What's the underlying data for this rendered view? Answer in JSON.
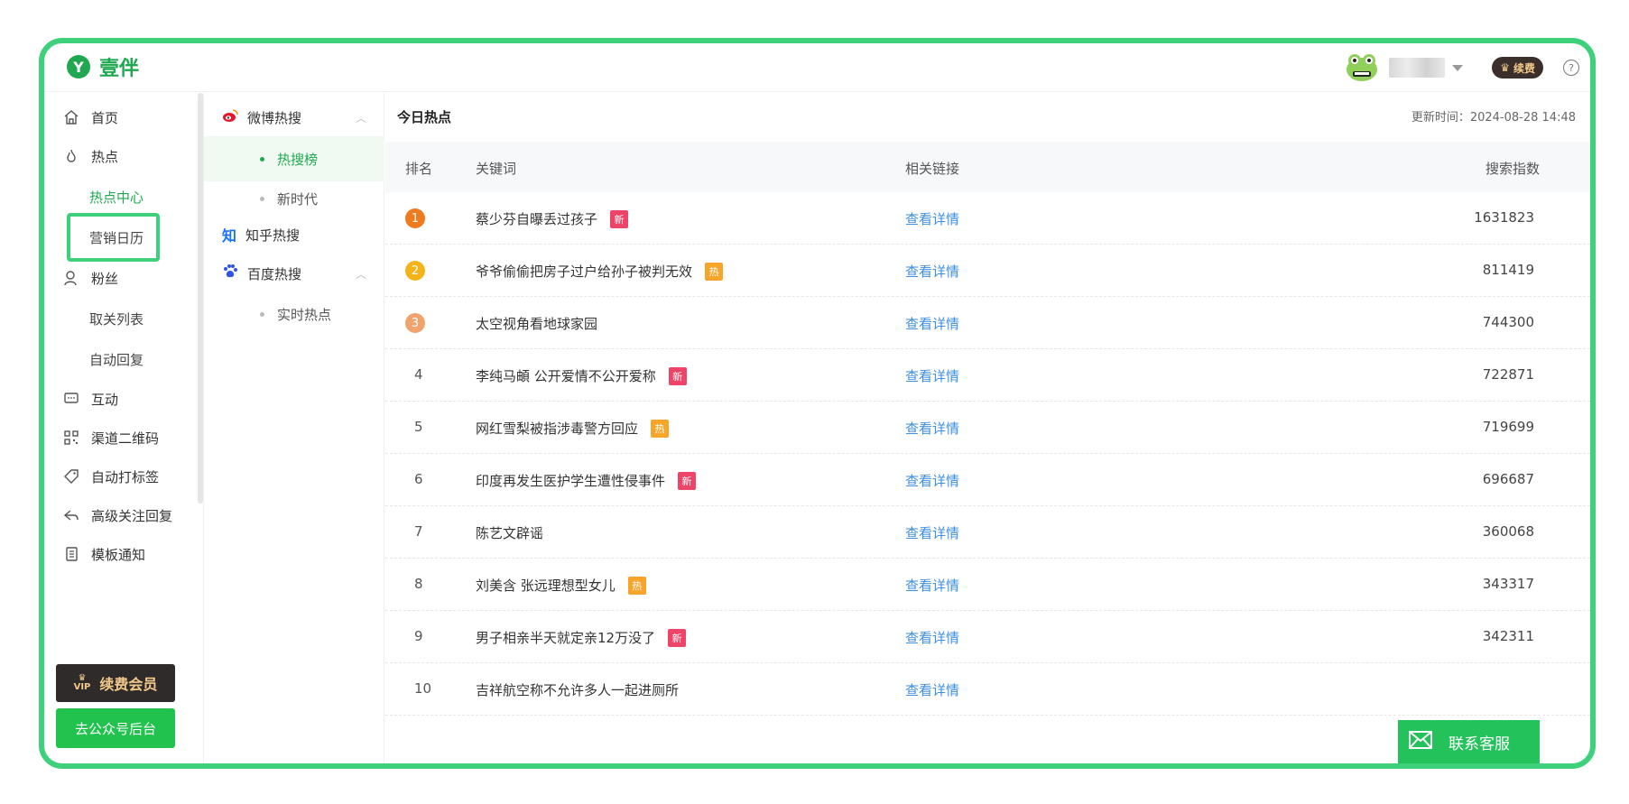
{
  "brand": {
    "logo_letter": "Y",
    "name": "壹伴"
  },
  "header": {
    "renew_label": "续费",
    "help": "?"
  },
  "sidebar": {
    "items": [
      {
        "label": "首页",
        "icon": "home-icon"
      },
      {
        "label": "热点",
        "icon": "flame-icon"
      },
      {
        "label": "热点中心",
        "sub": true,
        "active": true
      },
      {
        "label": "营销日历",
        "sub": true
      },
      {
        "label": "粉丝",
        "icon": "user-icon"
      },
      {
        "label": "取关列表",
        "sub": true
      },
      {
        "label": "自动回复",
        "sub": true
      },
      {
        "label": "互动",
        "icon": "chat-icon"
      },
      {
        "label": "渠道二维码",
        "icon": "qrcode-icon"
      },
      {
        "label": "自动打标签",
        "icon": "tag-icon"
      },
      {
        "label": "高级关注回复",
        "icon": "reply-icon"
      },
      {
        "label": "模板通知",
        "icon": "document-icon"
      }
    ],
    "vip_button": "续费会员",
    "vip_crown_text": "VIP",
    "go_button": "去公众号后台"
  },
  "sources": {
    "weibo": {
      "label": "微博热搜",
      "children": [
        "热搜榜",
        "新时代"
      ]
    },
    "zhihu": {
      "label": "知乎热搜",
      "icon_text": "知"
    },
    "baidu": {
      "label": "百度热搜",
      "children": [
        "实时热点"
      ]
    }
  },
  "main": {
    "title": "今日热点",
    "updated": "更新时间：2024-08-28 14:48",
    "columns": {
      "rank": "排名",
      "keyword": "关键词",
      "link": "相关链接",
      "index": "搜索指数"
    },
    "rows": [
      {
        "rank": "1",
        "keyword": "蔡少芬自曝丢过孩子",
        "tag": "新",
        "tag_type": "new",
        "link": "查看详情",
        "index": "1631823"
      },
      {
        "rank": "2",
        "keyword": "爷爷偷偷把房子过户给孙子被判无效",
        "tag": "热",
        "tag_type": "hot",
        "link": "查看详情",
        "index": "811419"
      },
      {
        "rank": "3",
        "keyword": "太空视角看地球家园",
        "tag": "",
        "tag_type": "",
        "link": "查看详情",
        "index": "744300"
      },
      {
        "rank": "4",
        "keyword": "李纯马頔 公开爱情不公开爱称",
        "tag": "新",
        "tag_type": "new",
        "link": "查看详情",
        "index": "722871"
      },
      {
        "rank": "5",
        "keyword": "网红雪梨被指涉毒警方回应",
        "tag": "热",
        "tag_type": "hot",
        "link": "查看详情",
        "index": "719699"
      },
      {
        "rank": "6",
        "keyword": "印度再发生医护学生遭性侵事件",
        "tag": "新",
        "tag_type": "new",
        "link": "查看详情",
        "index": "696687"
      },
      {
        "rank": "7",
        "keyword": "陈艺文辟谣",
        "tag": "",
        "tag_type": "",
        "link": "查看详情",
        "index": "360068"
      },
      {
        "rank": "8",
        "keyword": "刘美含 张远理想型女儿",
        "tag": "热",
        "tag_type": "hot",
        "link": "查看详情",
        "index": "343317"
      },
      {
        "rank": "9",
        "keyword": "男子相亲半天就定亲12万没了",
        "tag": "新",
        "tag_type": "new",
        "link": "查看详情",
        "index": "342311"
      },
      {
        "rank": "10",
        "keyword": "吉祥航空称不允许多人一起进厕所",
        "tag": "",
        "tag_type": "",
        "link": "查看详情",
        "index": ""
      }
    ],
    "rank_colors": [
      "#f07a1e",
      "#f5b31a",
      "#f0a36f"
    ]
  },
  "service": {
    "label": "联系客服"
  },
  "colors": {
    "brand_green": "#1fa84f",
    "frame_green": "#3fd07c",
    "link_blue": "#3d8fe0",
    "new_tag": "#ef4367",
    "hot_tag": "#f7a52a"
  }
}
